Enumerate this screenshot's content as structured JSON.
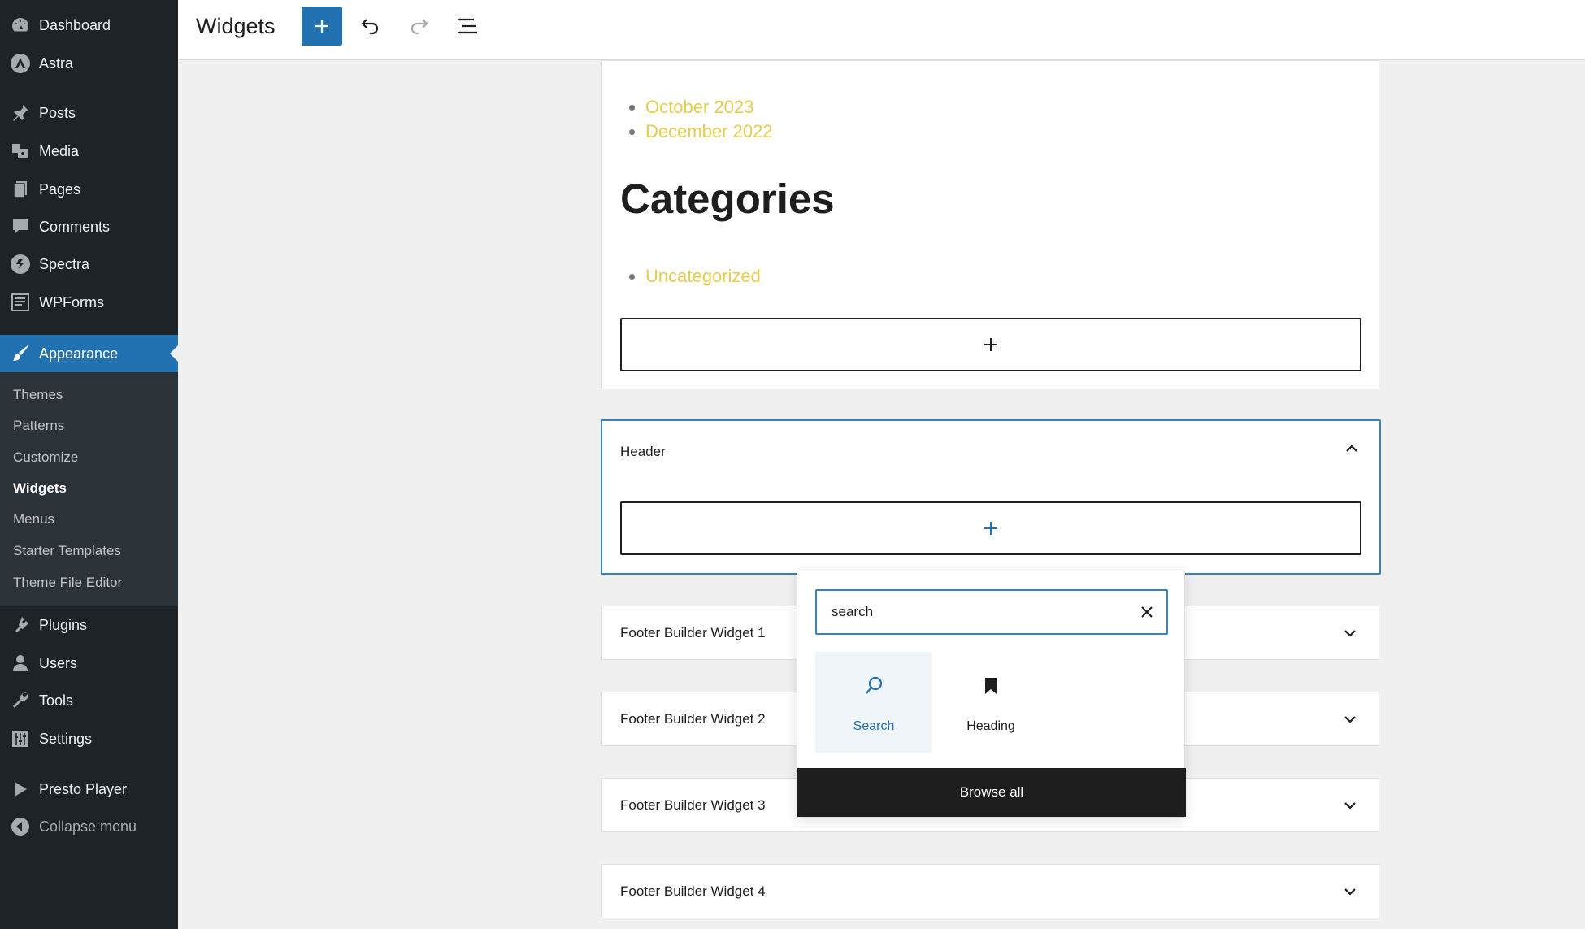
{
  "sidebar": {
    "dashboard": "Dashboard",
    "astra": "Astra",
    "posts": "Posts",
    "media": "Media",
    "pages": "Pages",
    "comments": "Comments",
    "spectra": "Spectra",
    "wpforms": "WPForms",
    "appearance": "Appearance",
    "submenu": {
      "themes": "Themes",
      "patterns": "Patterns",
      "customize": "Customize",
      "widgets": "Widgets",
      "menus": "Menus",
      "starter_templates": "Starter Templates",
      "theme_file_editor": "Theme File Editor"
    },
    "plugins": "Plugins",
    "users": "Users",
    "tools": "Tools",
    "settings": "Settings",
    "presto_player": "Presto Player",
    "collapse": "Collapse menu"
  },
  "topbar": {
    "title": "Widgets"
  },
  "content": {
    "archives": [
      "October 2023",
      "December 2022"
    ],
    "categories_heading": "Categories",
    "categories": [
      "Uncategorized"
    ],
    "header_area": "Header",
    "footer_widgets": [
      "Footer Builder Widget 1",
      "Footer Builder Widget 2",
      "Footer Builder Widget 3",
      "Footer Builder Widget 4"
    ]
  },
  "inserter": {
    "search_value": "search",
    "results": [
      "Search",
      "Heading"
    ],
    "browse_all": "Browse all"
  },
  "colors": {
    "accent": "#2271b1",
    "link": "#e6cc4d",
    "sidebar": "#1d2327"
  }
}
